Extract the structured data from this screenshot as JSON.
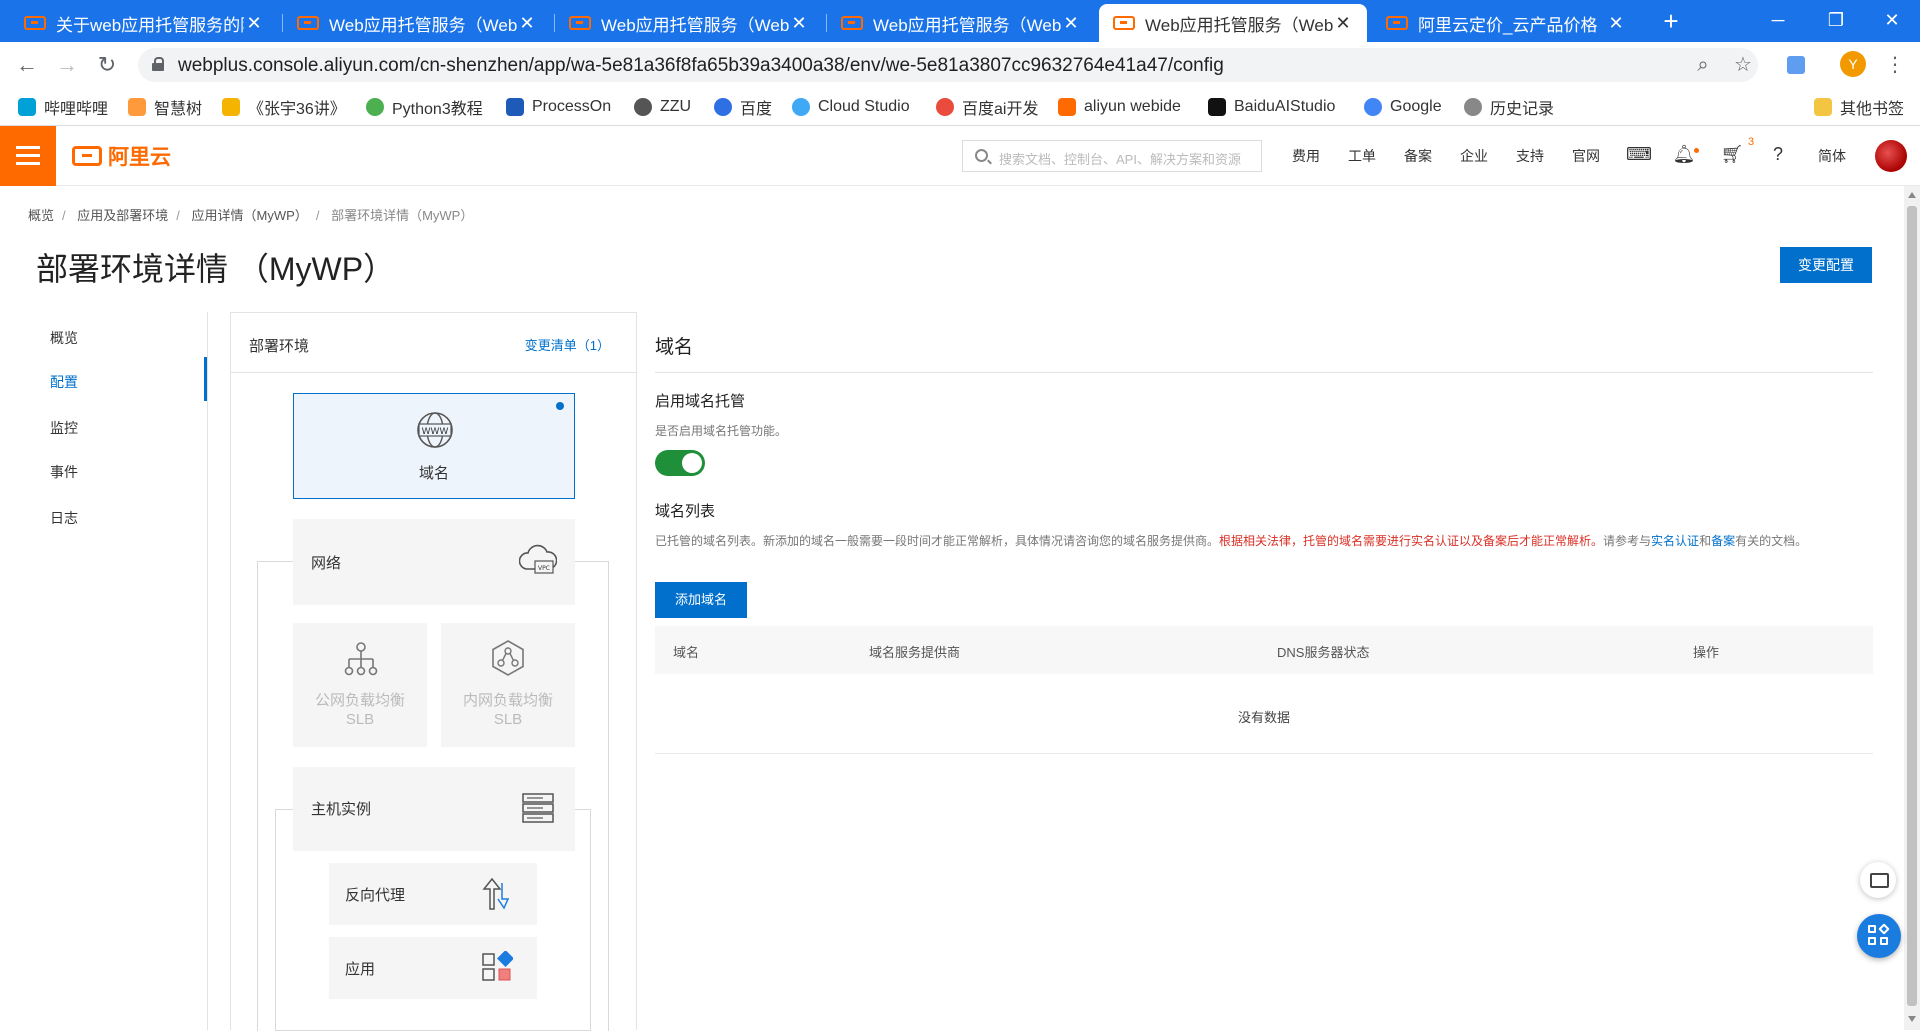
{
  "browser": {
    "tabs": [
      {
        "title": "关于web应用托管服务的阿里",
        "active": false
      },
      {
        "title": "Web应用托管服务（Web+）",
        "active": false
      },
      {
        "title": "Web应用托管服务（Web+）",
        "active": false
      },
      {
        "title": "Web应用托管服务（Web+）",
        "active": false
      },
      {
        "title": "Web应用托管服务（Web+）",
        "active": true
      },
      {
        "title": "阿里云定价_云产品价格",
        "active": false
      }
    ],
    "url": "webplus.console.aliyun.com/cn-shenzhen/app/wa-5e81a36f8fa65b39a3400a38/env/we-5e81a3807cc9632764e41a47/config",
    "profile_initial": "Y",
    "bookmarks": [
      "哔哩哔哩",
      "智慧树",
      "《张宇36讲》",
      "Python3教程",
      "ProcessOn",
      "ZZU",
      "百度",
      "Cloud Studio",
      "百度ai开发",
      "aliyun webide",
      "BaiduAIStudio",
      "Google",
      "历史记录"
    ],
    "bookmarks_other": "其他书签"
  },
  "header": {
    "logo": "阿里云",
    "search_placeholder": "搜索文档、控制台、API、解决方案和资源",
    "links": [
      "费用",
      "工单",
      "备案",
      "企业",
      "支持",
      "官网"
    ],
    "cart_badge": "3",
    "lang": "简体"
  },
  "breadcrumb": [
    "概览",
    "应用及部署环境",
    "应用详情（MyWP）",
    "部署环境详情（MyWP）"
  ],
  "page_title": "部署环境详情 （MyWP）",
  "change_config_label": "变更配置",
  "side_nav": {
    "items": [
      "概览",
      "配置",
      "监控",
      "事件",
      "日志"
    ],
    "active_index": 1
  },
  "env_panel": {
    "title": "部署环境",
    "changes_link": "变更清单（1）",
    "nodes": {
      "domain": "域名",
      "network": "网络",
      "public_slb_1": "公网负载均衡",
      "public_slb_2": "SLB",
      "private_slb_1": "内网负载均衡",
      "private_slb_2": "SLB",
      "host": "主机实例",
      "proxy": "反向代理",
      "app": "应用"
    }
  },
  "main": {
    "title": "域名",
    "hosting_label": "启用域名托管",
    "hosting_desc": "是否启用域名托管功能。",
    "hosting_enabled": true,
    "list_label": "域名列表",
    "list_desc_1": "已托管的域名列表。新添加的域名一般需要一段时间才能正常解析，具体情况请咨询您的域名服务提供商。",
    "list_desc_warn": "根据相关法律，托管的域名需要进行实名认证以及备案后才能正常解析。",
    "list_desc_2": "请参考与",
    "list_desc_link1": "实名认证",
    "list_desc_3": "和",
    "list_desc_link2": "备案",
    "list_desc_4": "有关的文档。",
    "add_domain_label": "添加域名",
    "table_headers": [
      "域名",
      "域名服务提供商",
      "DNS服务器状态",
      "操作"
    ],
    "empty_text": "没有数据"
  }
}
